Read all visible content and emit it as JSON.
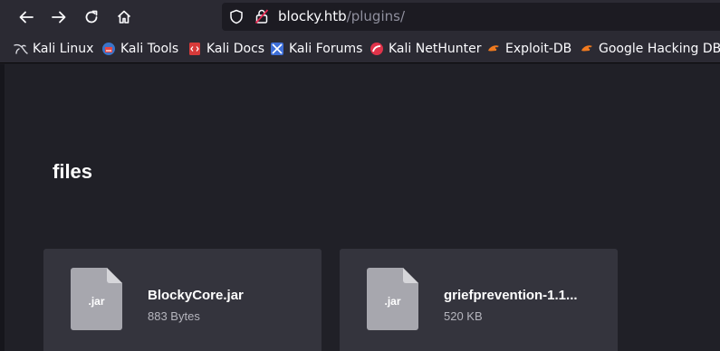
{
  "toolbar": {
    "back_icon": "arrow-left-icon",
    "forward_icon": "arrow-right-icon",
    "reload_icon": "reload-icon",
    "home_icon": "home-icon"
  },
  "urlbar": {
    "host": "blocky.htb",
    "path": "/plugins/"
  },
  "bookmarks": [
    {
      "label": "Kali Linux",
      "icon": "kali-dragon-icon"
    },
    {
      "label": "Kali Tools",
      "icon": "kali-tools-icon"
    },
    {
      "label": "Kali Docs",
      "icon": "kali-docs-icon"
    },
    {
      "label": "Kali Forums",
      "icon": "kali-forums-icon"
    },
    {
      "label": "Kali NetHunter",
      "icon": "kali-nethunter-icon"
    },
    {
      "label": "Exploit-DB",
      "icon": "exploit-db-icon"
    },
    {
      "label": "Google Hacking DB",
      "icon": "ghdb-icon"
    }
  ],
  "page": {
    "heading": "files",
    "files": [
      {
        "ext": ".jar",
        "name": "BlockyCore.jar",
        "size": "883 Bytes"
      },
      {
        "ext": ".jar",
        "name": "griefprevention-1.1...",
        "size": "520 KB"
      }
    ]
  },
  "colors": {
    "toolbar_bg": "#2b2a33",
    "page_bg": "#202027",
    "card_bg": "#34343d",
    "file_icon": "#a7a7ae",
    "url_path": "#8f8f9d"
  }
}
